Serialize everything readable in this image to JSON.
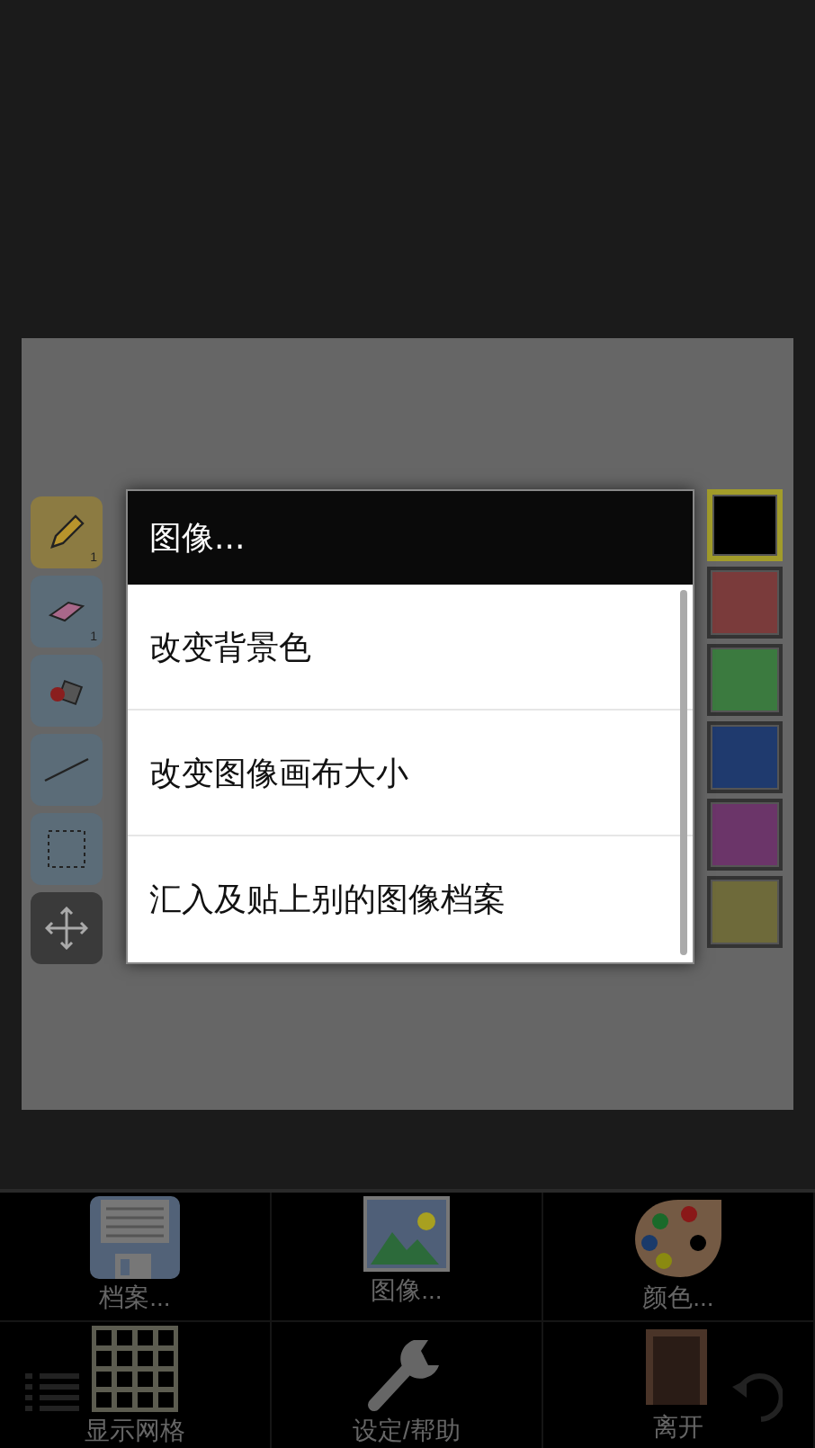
{
  "tools": [
    {
      "kind": "pencil",
      "number": "1",
      "selected": true
    },
    {
      "kind": "eraser",
      "number": "1",
      "selected": false
    },
    {
      "kind": "fill",
      "selected": false
    },
    {
      "kind": "line",
      "selected": false
    },
    {
      "kind": "select",
      "selected": false
    },
    {
      "kind": "move",
      "selected": false
    }
  ],
  "palette": [
    {
      "color": "#000000",
      "selected": true
    },
    {
      "color": "#7a3b3b",
      "selected": false
    },
    {
      "color": "#3b7a3f",
      "selected": false
    },
    {
      "color": "#1f3a6e",
      "selected": false
    },
    {
      "color": "#6b3569",
      "selected": false
    },
    {
      "color": "#6e6a3a",
      "selected": false
    }
  ],
  "dialog": {
    "title": "图像...",
    "items": [
      "改变背景色",
      "改变图像画布大小",
      "汇入及贴上别的图像档案"
    ]
  },
  "toolbar": [
    {
      "kind": "file",
      "label": "档案..."
    },
    {
      "kind": "image",
      "label": "图像..."
    },
    {
      "kind": "colors",
      "label": "颜色..."
    },
    {
      "kind": "grid",
      "label": "显示网格"
    },
    {
      "kind": "settings",
      "label": "设定/帮助"
    },
    {
      "kind": "exit",
      "label": "离开"
    }
  ]
}
